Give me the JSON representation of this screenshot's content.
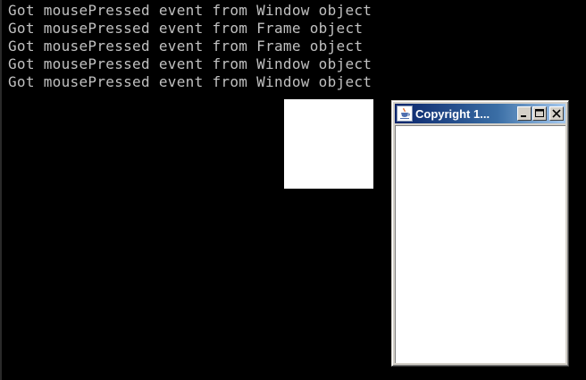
{
  "console": {
    "lines": [
      "Got mousePressed event from Window object",
      "Got mousePressed event from Frame object",
      "Got mousePressed event from Frame object",
      "Got mousePressed event from Window object",
      "Got mousePressed event from Window object"
    ],
    "text_color": "#c0c0c0",
    "background": "#000000"
  },
  "frame_window": {
    "title": "Copyright 1...",
    "icon": "java-cup-icon",
    "controls": {
      "minimize": "minimize-icon",
      "maximize": "maximize-icon",
      "close": "close-icon"
    },
    "titlebar_color": "#0a246a"
  },
  "plain_window": {
    "background": "#ffffff"
  }
}
